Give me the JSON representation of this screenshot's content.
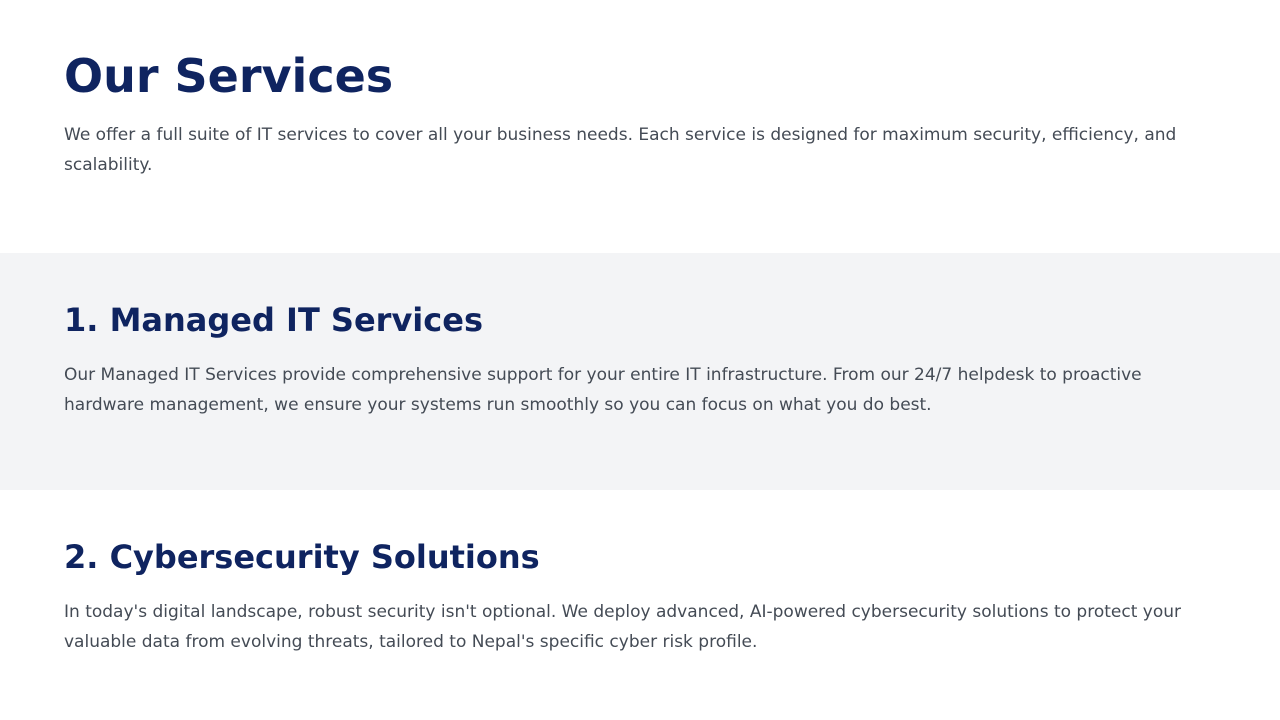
{
  "page": {
    "title": "Our Services",
    "intro": "We offer a full suite of IT services to cover all your business needs. Each service is designed for maximum security, efficiency, and scalability."
  },
  "services": [
    {
      "heading": "1. Managed IT Services",
      "description": "Our Managed IT Services provide comprehensive support for your entire IT infrastructure. From our 24/7 helpdesk to proactive hardware management, we ensure your systems run smoothly so you can focus on what you do best."
    },
    {
      "heading": "2. Cybersecurity Solutions",
      "description": "In today's digital landscape, robust security isn't optional. We deploy advanced, AI-powered cybersecurity solutions to protect your valuable data from evolving threats, tailored to Nepal's specific cyber risk profile."
    }
  ],
  "colors": {
    "heading": "#0f2460",
    "body_text": "#444b55",
    "alt_section_bg": "#f3f4f6",
    "page_bg": "#ffffff"
  }
}
